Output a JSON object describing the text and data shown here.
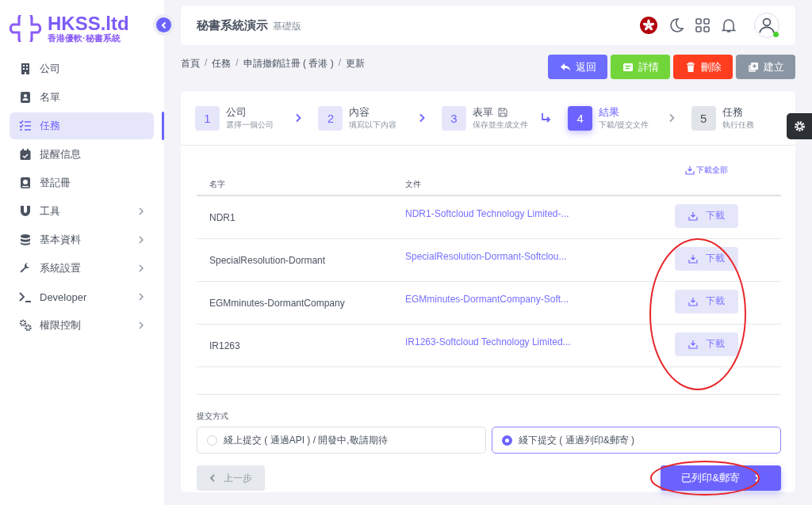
{
  "brand": {
    "name": "HKSS.ltd",
    "tagline": "香港優軟·秘書系統"
  },
  "sidebar": {
    "items": [
      {
        "label": "公司",
        "kind": "building",
        "selected": false,
        "expandable": false
      },
      {
        "label": "名單",
        "kind": "contact",
        "selected": false,
        "expandable": false
      },
      {
        "label": "任務",
        "kind": "checklist",
        "selected": true,
        "expandable": false
      },
      {
        "label": "提醒信息",
        "kind": "calendar",
        "selected": false,
        "expandable": false
      },
      {
        "label": "登記冊",
        "kind": "book",
        "selected": false,
        "expandable": false
      },
      {
        "label": "工具",
        "kind": "magnet",
        "selected": false,
        "expandable": true
      },
      {
        "label": "基本資料",
        "kind": "database",
        "selected": false,
        "expandable": true
      },
      {
        "label": "系統設置",
        "kind": "wrench",
        "selected": false,
        "expandable": true
      },
      {
        "label": "Developer",
        "kind": "terminal",
        "selected": false,
        "expandable": true
      },
      {
        "label": "權限控制",
        "kind": "gears",
        "selected": false,
        "expandable": true
      }
    ]
  },
  "header": {
    "title": "秘書系統演示",
    "edition": "基礎版",
    "user_online": true
  },
  "breadcrumb": [
    {
      "label": "首頁",
      "kind": "link"
    },
    {
      "label": "/",
      "kind": "separator"
    },
    {
      "label": "任務",
      "kind": "link"
    },
    {
      "label": "/",
      "kind": "separator"
    },
    {
      "label": "申請撤銷註冊 ( 香港 )",
      "kind": "link"
    },
    {
      "label": "/",
      "kind": "separator"
    },
    {
      "label": "更新",
      "kind": "current"
    }
  ],
  "actions": [
    {
      "label": "返回",
      "kind": "back"
    },
    {
      "label": "詳情",
      "kind": "details"
    },
    {
      "label": "刪除",
      "kind": "delete"
    },
    {
      "label": "建立",
      "kind": "create"
    }
  ],
  "steps": [
    {
      "number": "1",
      "title": "公司",
      "subtitle": "選擇一個公司",
      "completed": true,
      "selected": false,
      "save_icon": false
    },
    {
      "number": "2",
      "title": "內容",
      "subtitle": "填寫以下內容",
      "completed": true,
      "selected": false,
      "save_icon": false
    },
    {
      "number": "3",
      "title": "表單",
      "subtitle": "保存並生成文件",
      "completed": true,
      "selected": false,
      "save_icon": true
    },
    {
      "number": "4",
      "title": "結果",
      "subtitle": "下載/提交文件",
      "selected": true,
      "save_icon": false
    },
    {
      "number": "5",
      "title": "任務",
      "subtitle": "執行任務",
      "completed": false,
      "selected": false,
      "save_icon": false
    }
  ],
  "table": {
    "columns": [
      "名字",
      "文件"
    ],
    "download_all": "下載全部",
    "download_highlighted": true,
    "rows": [
      {
        "name": "NDR1",
        "file": "NDR1-Softcloud Technology Limited-...",
        "download": "下載"
      },
      {
        "name": "SpecialResolution-Dormant",
        "file": "SpecialResolution-Dormant-Softclou...",
        "download": "下載"
      },
      {
        "name": "EGMminutes-DormantCompany",
        "file": "EGMminutes-DormantCompany-Soft...",
        "download": "下載"
      },
      {
        "name": "IR1263",
        "file": "IR1263-Softcloud Technology Limited...",
        "download": "下載"
      }
    ]
  },
  "submission": {
    "label": "提交方式",
    "options": [
      {
        "label": "綫上提交 ( 通過API ) / 開發中,敬請期待",
        "selected": false
      },
      {
        "label": "綫下提交 ( 通過列印&郵寄 )",
        "selected": true
      }
    ]
  },
  "prev_button": {
    "label": "上一步",
    "disabled": true
  },
  "next_button": {
    "label": "已列印&郵寄",
    "highlighted": true
  }
}
